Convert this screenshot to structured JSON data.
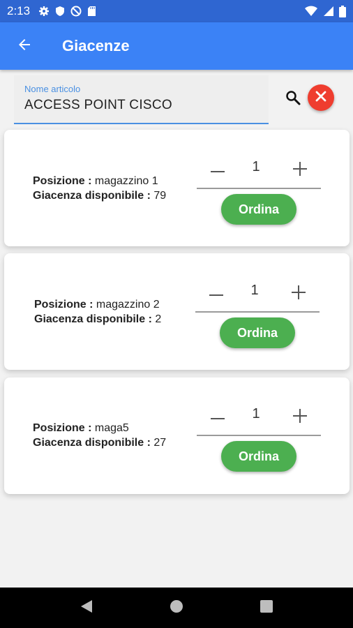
{
  "status_bar": {
    "time": "2:13",
    "left_icons": [
      "settings-icon",
      "shield-icon",
      "do-not-disturb-icon",
      "sd-card-icon"
    ],
    "right_icons": [
      "wifi-icon",
      "signal-icon",
      "battery-icon"
    ]
  },
  "app_bar": {
    "back_icon": "arrow-left-icon",
    "title": "Giacenze"
  },
  "search": {
    "label": "Nome articolo",
    "value": "ACCESS POINT CISCO",
    "search_icon": "search-icon",
    "clear_icon": "close-icon"
  },
  "labels": {
    "position": "Posizione :",
    "stock": "Giacenza disponibile :"
  },
  "stock_items": [
    {
      "position": "magazzino 1",
      "stock": "79",
      "quantity": "1",
      "order_label": "Ordina"
    },
    {
      "position": "magazzino 2",
      "stock": "2",
      "quantity": "1",
      "order_label": "Ordina"
    },
    {
      "position": "maga5",
      "stock": "27",
      "quantity": "1",
      "order_label": "Ordina"
    }
  ],
  "nav_bar": {
    "icons": [
      "back-triangle-icon",
      "home-circle-icon",
      "recents-square-icon"
    ]
  },
  "colors": {
    "status_bar": "#2f66d1",
    "app_bar": "#3b82f6",
    "accent": "#4a90e2",
    "clear_button": "#ef3d2f",
    "order_button": "#4caf50"
  }
}
